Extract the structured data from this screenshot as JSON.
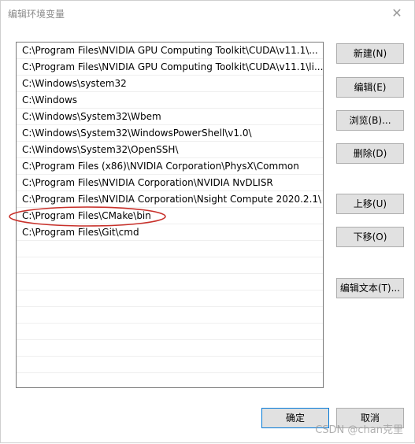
{
  "window": {
    "title": "编辑环境变量",
    "close_glyph": "✕"
  },
  "path_list": {
    "items": [
      "C:\\Program Files\\NVIDIA GPU Computing Toolkit\\CUDA\\v11.1\\...",
      "C:\\Program Files\\NVIDIA GPU Computing Toolkit\\CUDA\\v11.1\\li...",
      "C:\\Windows\\system32",
      "C:\\Windows",
      "C:\\Windows\\System32\\Wbem",
      "C:\\Windows\\System32\\WindowsPowerShell\\v1.0\\",
      "C:\\Windows\\System32\\OpenSSH\\",
      "C:\\Program Files (x86)\\NVIDIA Corporation\\PhysX\\Common",
      "C:\\Program Files\\NVIDIA Corporation\\NVIDIA NvDLISR",
      "C:\\Program Files\\NVIDIA Corporation\\Nsight Compute 2020.2.1\\",
      "C:\\Program Files\\CMake\\bin",
      "C:\\Program Files\\Git\\cmd"
    ],
    "highlighted_index": 10,
    "highlight_color": "#c8302a"
  },
  "buttons": {
    "new": "新建(N)",
    "edit": "编辑(E)",
    "browse": "浏览(B)...",
    "delete": "删除(D)",
    "move_up": "上移(U)",
    "move_down": "下移(O)",
    "edit_text": "编辑文本(T)...",
    "ok": "确定",
    "cancel": "取消"
  },
  "watermark": {
    "text": "CSDN @chan克里"
  }
}
